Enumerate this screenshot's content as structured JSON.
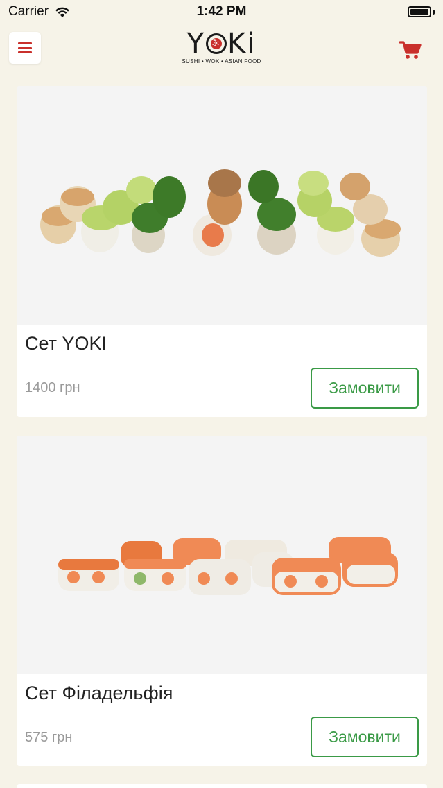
{
  "status_bar": {
    "carrier": "Carrier",
    "time": "1:42 PM"
  },
  "header": {
    "logo_text_left": "Y",
    "logo_text_right": "Ki",
    "logo_glyph": "永",
    "logo_tagline": "SUSHI • WOK • ASIAN FOOD",
    "menu_icon": "hamburger-menu-icon",
    "cart_icon": "shopping-cart-icon"
  },
  "colors": {
    "background": "#f6f3e8",
    "accent_red": "#c9302c",
    "order_green": "#3a9a46",
    "price_grey": "#9a9a9a"
  },
  "products": [
    {
      "title": "Сет YOKI",
      "price": "1400 грн",
      "order_label": "Замовити"
    },
    {
      "title": "Сет Філадельфія",
      "price": "575 грн",
      "order_label": "Замовити"
    }
  ]
}
